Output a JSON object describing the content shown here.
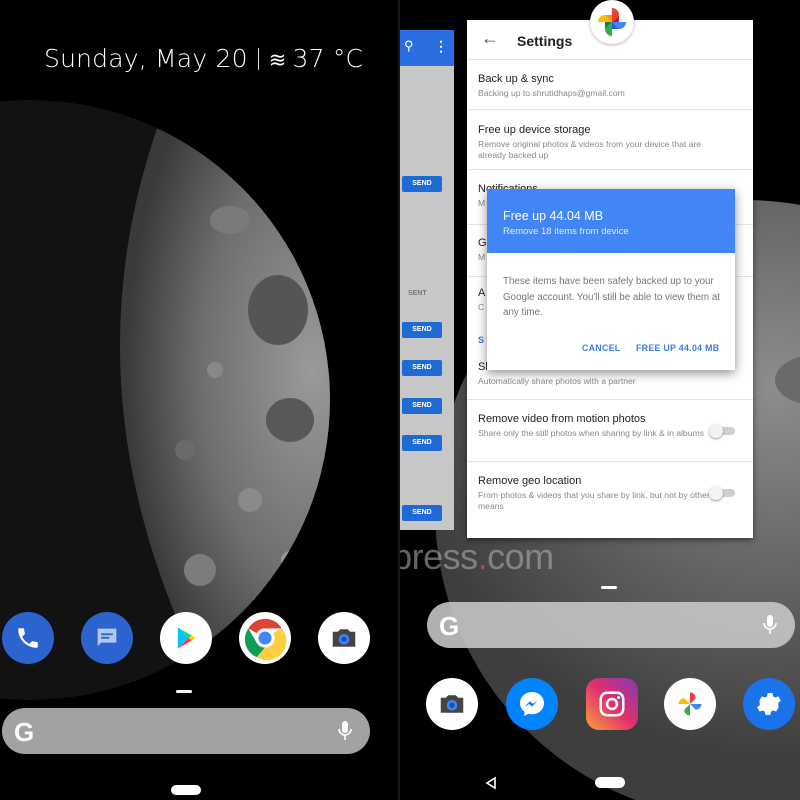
{
  "left_screen": {
    "date": "Sunday, May 20",
    "weather": "37 °C",
    "dock_apps": [
      "Phone",
      "Messages",
      "Play Store",
      "Chrome",
      "Camera"
    ],
    "search_bar": {
      "logo": "G",
      "icon": "mic-icon"
    }
  },
  "right_screen": {
    "messaging_card": {
      "send_label": "SEND",
      "sent_label": "SENT"
    },
    "settings": {
      "title": "Settings",
      "rows": [
        {
          "title": "Back up & sync",
          "subtitle": "Backing up to shrutidhaps@gmail.com"
        },
        {
          "title": "Free up device storage",
          "subtitle": "Remove original photos & videos from your device that are already backed up"
        },
        {
          "title": "Notifications",
          "subtitle": "M"
        },
        {
          "title": "G",
          "subtitle": "M"
        },
        {
          "title": "A",
          "subtitle": "C"
        },
        {
          "title": "S",
          "subtitle": ""
        },
        {
          "title": "Shared libraries",
          "subtitle": "Automatically share photos with a partner"
        },
        {
          "title": "Remove video from motion photos",
          "subtitle": "Share only the still photos when sharing by link & in albums"
        },
        {
          "title": "Remove geo location",
          "subtitle": "From photos & videos that you share by link, but not by other means"
        }
      ]
    },
    "dialog": {
      "title": "Free up 44.04 MB",
      "subtitle": "Remove 18 items from device",
      "body": "These items have been safely backed up to your Google account. You'll still be able to view them at any time.",
      "cancel": "CANCEL",
      "confirm": "FREE UP 44.04 MB"
    },
    "watermark": {
      "pre": "indianexpress",
      "dot": ".",
      "post": "com"
    },
    "search_bar": {
      "logo": "G",
      "icon": "mic-icon"
    },
    "dock_apps": [
      "Camera",
      "Messenger",
      "Instagram",
      "Photos",
      "Settings"
    ]
  },
  "colors": {
    "accent_blue": "#4285f4",
    "send_blue": "#1f6bd6",
    "dialog_button": "#3b7be8"
  }
}
